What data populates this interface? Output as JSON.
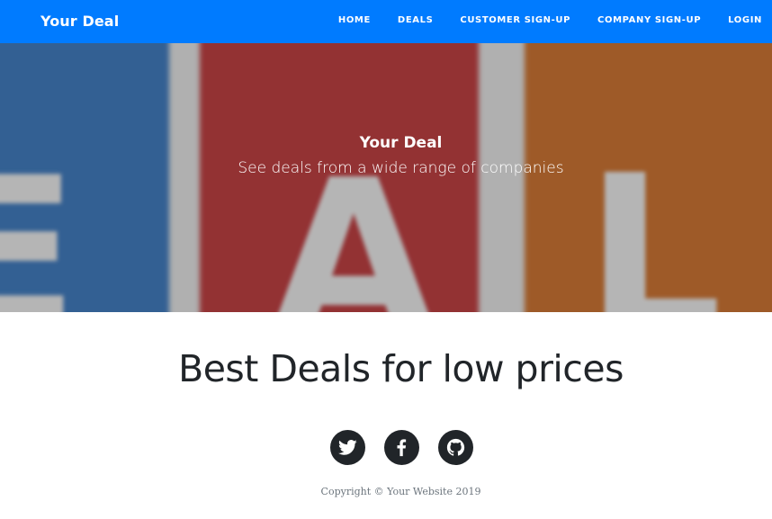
{
  "navbar": {
    "brand": "Your Deal",
    "links": {
      "home": "HOME",
      "deals": "DEALS",
      "customer_signup": "CUSTOMER SIGN-UP",
      "company_signup": "COMPANY SIGN-UP",
      "login": "LOGIN"
    },
    "background_color": "#007bff"
  },
  "hero": {
    "title": "Your Deal",
    "subtitle": "See deals from a wide range of companies"
  },
  "main": {
    "heading": "Best Deals for low prices"
  },
  "social": {
    "icons": [
      "twitter-icon",
      "facebook-icon",
      "github-icon"
    ]
  },
  "footer": {
    "copyright": "Copyright © Your Website 2019"
  }
}
